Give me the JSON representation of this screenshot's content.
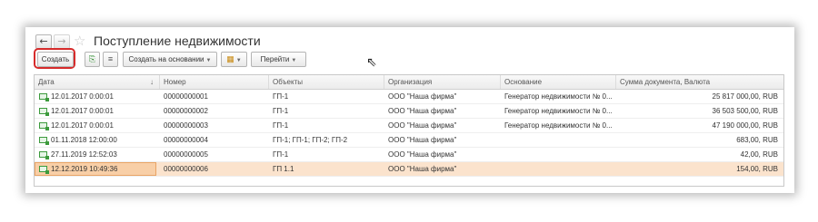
{
  "window": {
    "title": "Поступление недвижимости",
    "nav_back": "←",
    "nav_forward": "→",
    "favorite_icon": "star-icon"
  },
  "toolbar": {
    "create_label": "Создать",
    "copy_icon": "copy-document-icon",
    "list_icon": "list-icon",
    "based_on_label": "Создать на основании",
    "report_icon": "report-icon",
    "goto_label": "Перейти"
  },
  "table": {
    "columns": [
      "Дата",
      "Номер",
      "Объекты",
      "Организация",
      "Основание",
      "Сумма документа, Валюта"
    ],
    "sort_indicator": "↓",
    "rows": [
      {
        "date": "12.01.2017 0:00:01",
        "number": "00000000001",
        "objects": "ГП-1",
        "org": "ООО \"Наша фирма\"",
        "basis": "Генератор недвижимости № 0...",
        "amount": "25 817 000,00, RUB"
      },
      {
        "date": "12.01.2017 0:00:01",
        "number": "00000000002",
        "objects": "ГП-1",
        "org": "ООО \"Наша фирма\"",
        "basis": "Генератор недвижимости № 0...",
        "amount": "36 503 500,00, RUB"
      },
      {
        "date": "12.01.2017 0:00:01",
        "number": "00000000003",
        "objects": "ГП-1",
        "org": "ООО \"Наша фирма\"",
        "basis": "Генератор недвижимости № 0...",
        "amount": "47 190 000,00, RUB"
      },
      {
        "date": "01.11.2018 12:00:00",
        "number": "00000000004",
        "objects": "ГП-1; ГП-1; ГП-2; ГП-2",
        "org": "ООО \"Наша фирма\"",
        "basis": "",
        "amount": "683,00, RUB"
      },
      {
        "date": "27.11.2019 12:52:03",
        "number": "00000000005",
        "objects": "ГП-1",
        "org": "ООО \"Наша фирма\"",
        "basis": "",
        "amount": "42,00, RUB"
      },
      {
        "date": "12.12.2019 10:49:36",
        "number": "00000000006",
        "objects": "ГП 1.1",
        "org": "ООО \"Наша фирма\"",
        "basis": "",
        "amount": "154,00, RUB"
      }
    ],
    "selected_row": 5
  },
  "colors": {
    "selection_bg": "#fbe3cd",
    "selection_border": "#e9a465",
    "highlight_red": "#d62b2b"
  }
}
